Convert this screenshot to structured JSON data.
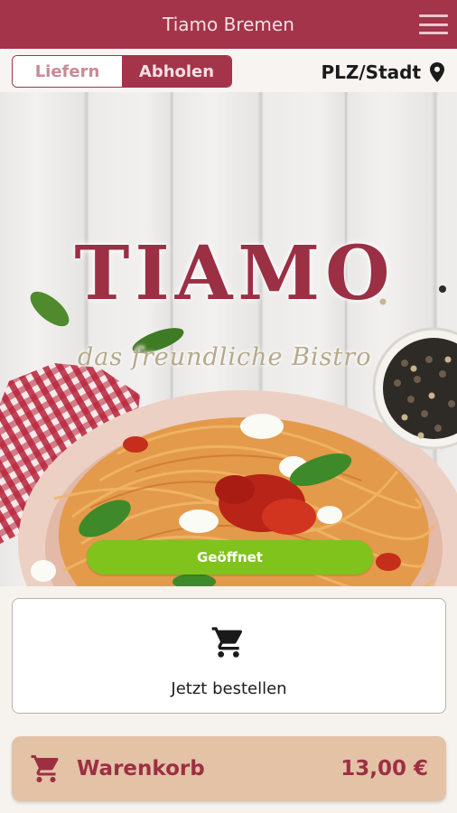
{
  "header": {
    "title": "Tiamo Bremen",
    "menu_icon": "hamburger-menu-icon"
  },
  "mode": {
    "options": [
      "Liefern",
      "Abholen"
    ],
    "selected": "Abholen"
  },
  "location": {
    "label": "PLZ/Stadt",
    "icon": "location-pin-icon"
  },
  "hero": {
    "brand": "TIAMO",
    "tagline": "das freundliche Bistro"
  },
  "status": {
    "label": "Geöffnet",
    "color": "#7fc31c"
  },
  "order": {
    "label": "Jetzt bestellen",
    "icon": "shopping-cart-icon"
  },
  "basket": {
    "label": "Warenkorb",
    "total": "13,00 €",
    "icon": "shopping-cart-icon"
  },
  "colors": {
    "brand": "#a3344a",
    "basket_bg": "#e3c2a6",
    "open_green": "#7fc31c"
  }
}
